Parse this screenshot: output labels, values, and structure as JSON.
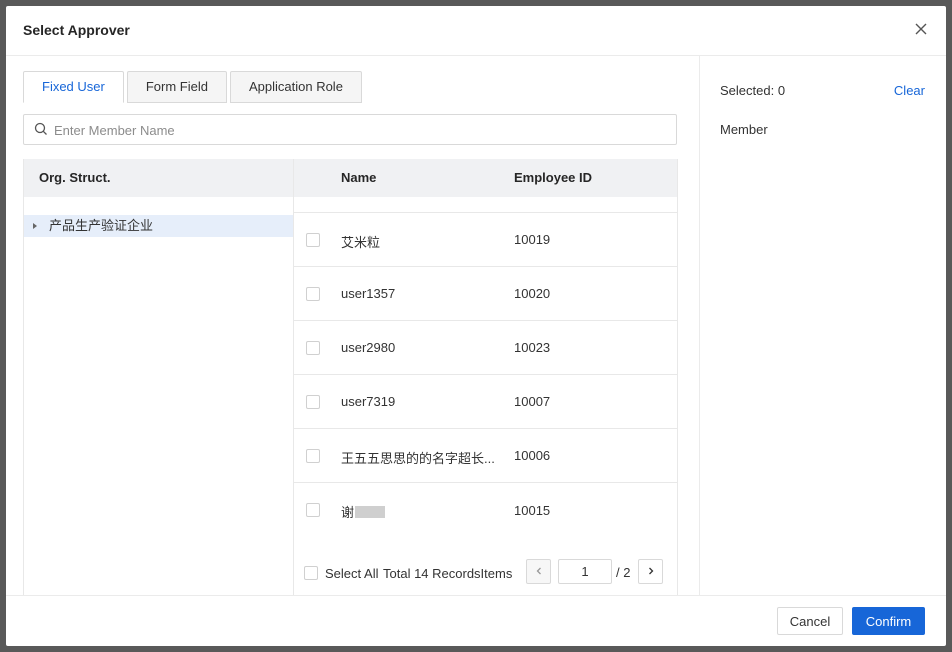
{
  "dialog": {
    "title": "Select Approver",
    "close_icon": "close-icon"
  },
  "tabs": [
    {
      "label": "Fixed User",
      "active": true
    },
    {
      "label": "Form Field",
      "active": false
    },
    {
      "label": "Application Role",
      "active": false
    }
  ],
  "search": {
    "placeholder": "Enter Member Name",
    "value": "",
    "icon": "search-icon"
  },
  "org": {
    "header": "Org. Struct.",
    "nodes": [
      {
        "label": "产品生产验证企业",
        "expanded": false,
        "selected": true
      }
    ]
  },
  "table": {
    "columns": {
      "name": "Name",
      "employee_id": "Employee ID"
    },
    "rows": [
      {
        "name": "艾米粒",
        "employee_id": "10019"
      },
      {
        "name": "user1357",
        "employee_id": "10020"
      },
      {
        "name": "user2980",
        "employee_id": "10023"
      },
      {
        "name": "user7319",
        "employee_id": "10007"
      },
      {
        "name": "王五五思思的的名字超长...",
        "employee_id": "10006"
      },
      {
        "name": "谢",
        "employee_id": "10015"
      }
    ],
    "select_all_label": "Select All",
    "total_label": "Total 14 RecordsItems",
    "pagination": {
      "current_page": "1",
      "total_pages": "/ 2",
      "prev_icon": "chevron-left-icon",
      "next_icon": "chevron-right-icon"
    }
  },
  "selection": {
    "selected_label": "Selected: 0",
    "clear_label": "Clear",
    "member_label": "Member"
  },
  "footer": {
    "cancel_label": "Cancel",
    "confirm_label": "Confirm"
  },
  "colors": {
    "accent": "#1766d8",
    "header_bg": "#f0f1f3",
    "selected_node_bg": "#e6eefa"
  }
}
